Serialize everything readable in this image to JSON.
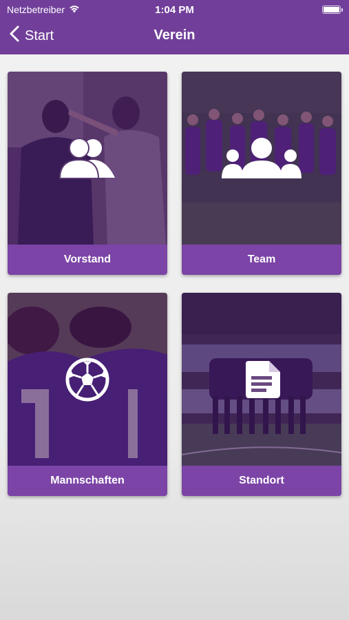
{
  "status_bar": {
    "carrier": "Netzbetreiber",
    "time": "1:04 PM"
  },
  "nav": {
    "back_label": "Start",
    "title": "Verein"
  },
  "tiles": [
    {
      "label": "Vorstand",
      "icon": "people-icon"
    },
    {
      "label": "Team",
      "icon": "group-icon"
    },
    {
      "label": "Mannschaften",
      "icon": "soccer-ball-icon"
    },
    {
      "label": "Standort",
      "icon": "document-icon"
    }
  ],
  "colors": {
    "primary": "#713f9a",
    "tile_label": "#7b44a6"
  }
}
